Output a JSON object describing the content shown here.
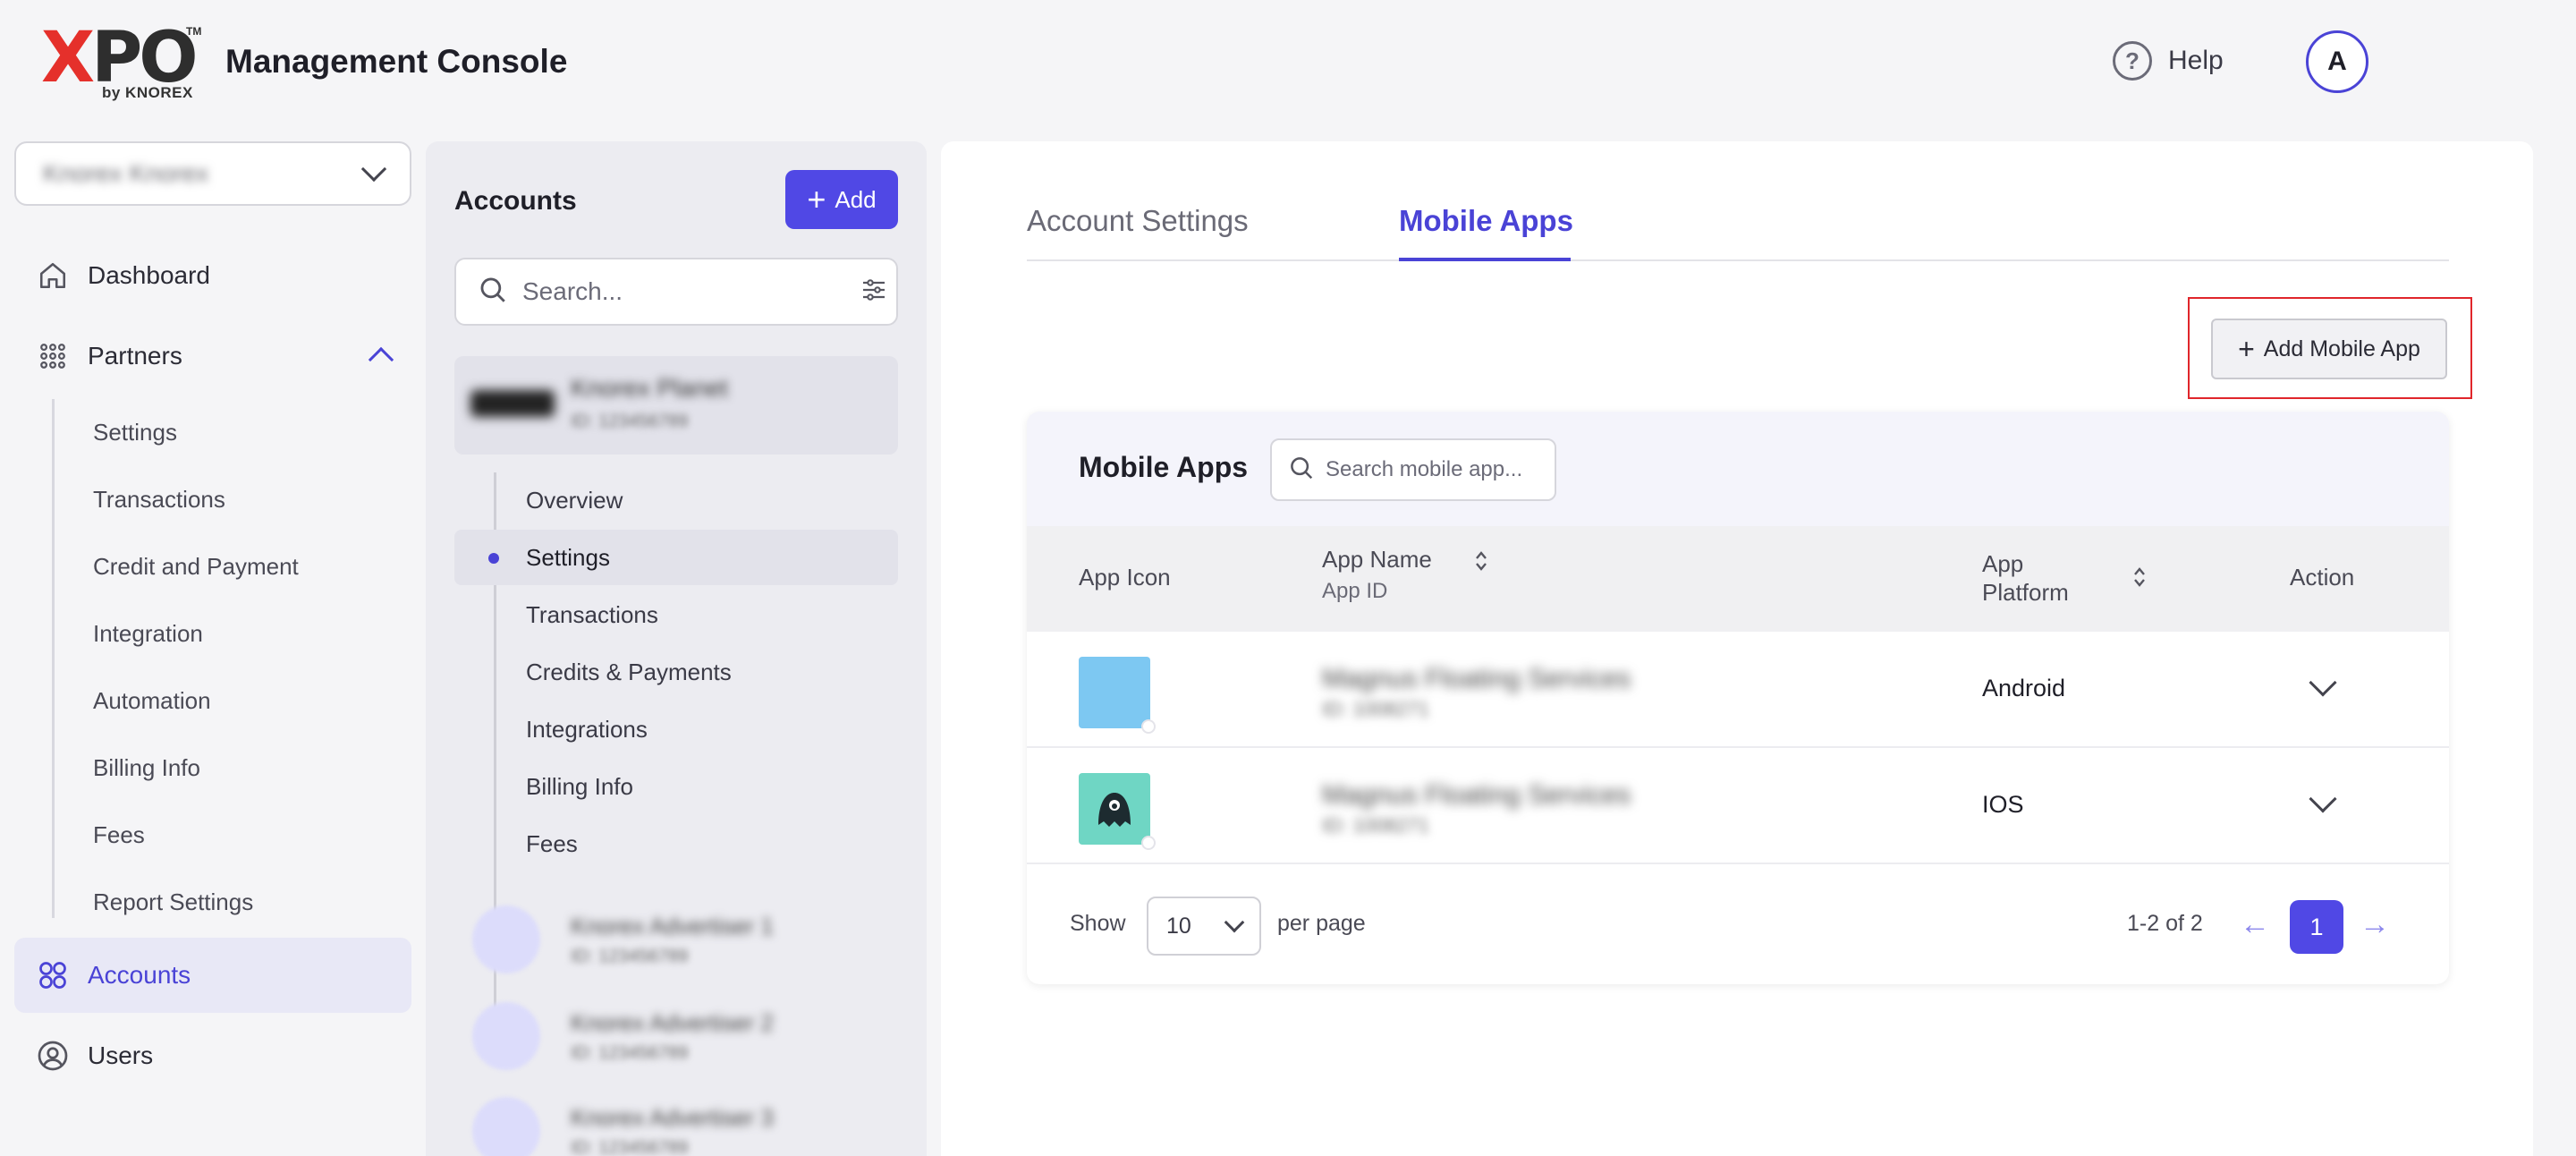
{
  "header": {
    "logo_letters": "XPO",
    "logo_tm": "TM",
    "logo_sub": "by KNOREX",
    "app_title": "Management Console",
    "help_label": "Help",
    "avatar_initial": "A"
  },
  "sidebar": {
    "org_selector_value": "Knorex Knorex",
    "items": [
      {
        "label": "Dashboard",
        "icon": "home-icon"
      },
      {
        "label": "Partners",
        "icon": "grid-icon"
      },
      {
        "label": "Accounts",
        "icon": "circles-icon"
      },
      {
        "label": "Users",
        "icon": "user-circle-icon"
      }
    ],
    "partner_sub_items": [
      "Settings",
      "Transactions",
      "Credit and Payment",
      "Integration",
      "Automation",
      "Billing Info",
      "Fees",
      "Report Settings"
    ],
    "accent": "#4a43d6"
  },
  "accounts_panel": {
    "title": "Accounts",
    "add_label": "Add",
    "search_placeholder": "Search...",
    "selected_account": {
      "name": "Knorex Planet",
      "id": "ID: 123456789"
    },
    "sub_items": [
      "Overview",
      "Settings",
      "Transactions",
      "Credits & Payments",
      "Integrations",
      "Billing Info",
      "Fees"
    ],
    "active_sub_item": "Settings",
    "other_accounts": [
      {
        "name": "Knorex Advertiser 1",
        "id": "ID: 123456789"
      },
      {
        "name": "Knorex Advertiser 2",
        "id": "ID: 123456789"
      },
      {
        "name": "Knorex Advertiser 3",
        "id": "ID: 123456789"
      }
    ]
  },
  "main": {
    "tabs": [
      {
        "label": "Account Settings",
        "active": false
      },
      {
        "label": "Mobile Apps",
        "active": true
      }
    ],
    "add_mobile_app_label": "Add Mobile App",
    "card": {
      "title": "Mobile Apps",
      "search_placeholder": "Search mobile app...",
      "columns": {
        "app_icon": "App Icon",
        "app_name": "App Name",
        "app_id": "App ID",
        "app_platform": "App Platform",
        "action": "Action"
      },
      "rows": [
        {
          "name": "Magnus Floating Services",
          "id": "ID: 1008271",
          "platform": "Android",
          "icon_color": "#7dc8f2"
        },
        {
          "name": "Magnus Floating Services",
          "id": "ID: 1008271",
          "platform": "IOS",
          "icon_color": "#6fd6c4"
        }
      ],
      "footer": {
        "show_label": "Show",
        "per_page_value": "10",
        "per_page_label": "per page",
        "range": "1-2 of 2",
        "current_page": "1"
      }
    }
  }
}
